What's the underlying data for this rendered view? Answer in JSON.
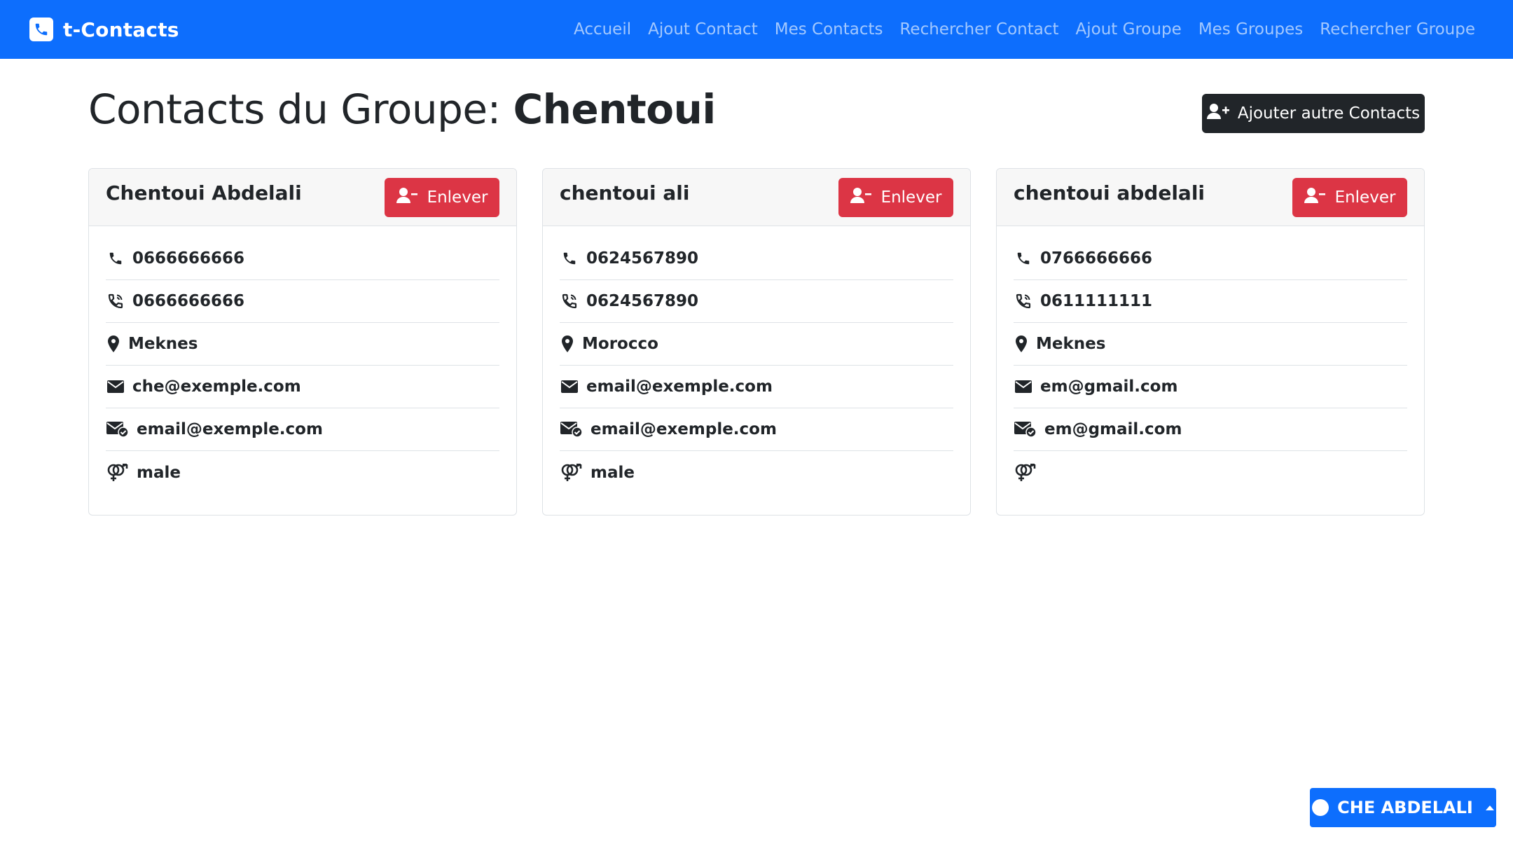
{
  "brand": {
    "name": "t-Contacts",
    "icon": "phone-square-icon"
  },
  "nav": {
    "links": [
      "Accueil",
      "Ajout Contact",
      "Mes Contacts",
      "Rechercher Contact",
      "Ajout Groupe",
      "Mes Groupes",
      "Rechercher Groupe"
    ]
  },
  "page": {
    "title_prefix": "Contacts du Groupe:",
    "group_name": "Chentoui",
    "add_button_label": "Ajouter autre Contacts",
    "add_button_icon": "user-plus-icon"
  },
  "contacts": [
    {
      "name": "Chentoui Abdelali",
      "remove_label": "Enlever",
      "phone": "0666666666",
      "phone2": "0666666666",
      "city": "Meknes",
      "email": "che@exemple.com",
      "email2": "email@exemple.com",
      "gender": "male"
    },
    {
      "name": "chentoui ali",
      "remove_label": "Enlever",
      "phone": "0624567890",
      "phone2": "0624567890",
      "city": "Morocco",
      "email": "email@exemple.com",
      "email2": "email@exemple.com",
      "gender": "male"
    },
    {
      "name": "chentoui abdelali",
      "remove_label": "Enlever",
      "phone": "0766666666",
      "phone2": "0611111111",
      "city": "Meknes",
      "email": "em@gmail.com",
      "email2": "em@gmail.com",
      "gender": ""
    }
  ],
  "user_menu": {
    "label": "CHE ABDELALI"
  },
  "colors": {
    "primary": "#0d6efd",
    "danger": "#dc3545",
    "dark": "#212529"
  }
}
